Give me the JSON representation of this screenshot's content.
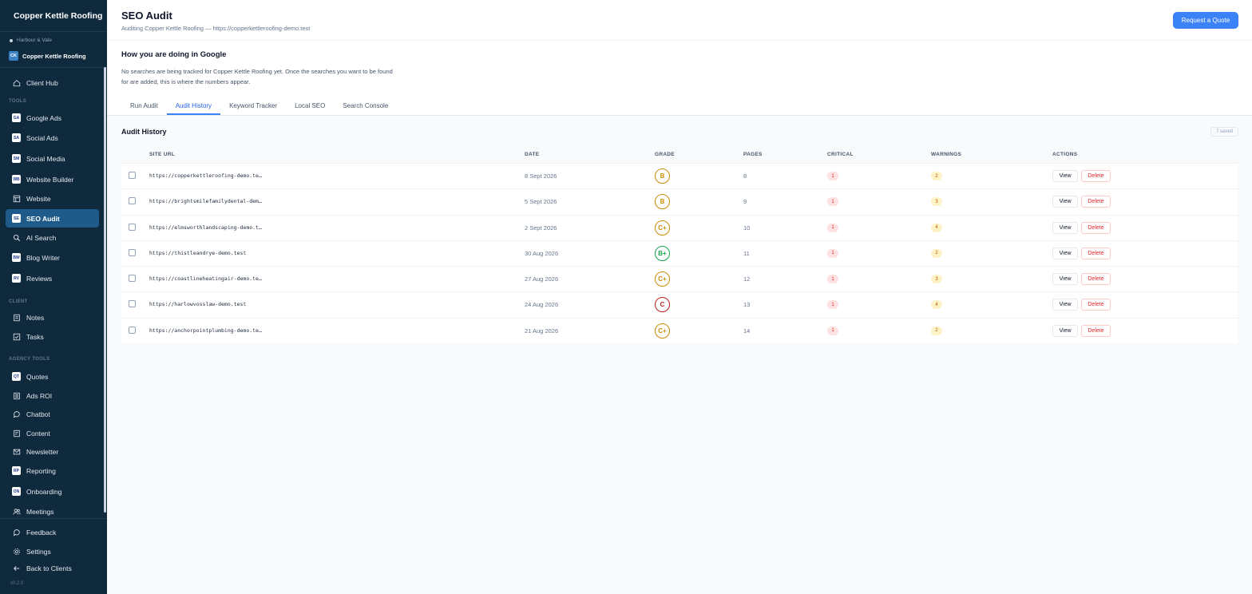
{
  "sidebar": {
    "brand": "Copper Kettle Roofing",
    "agency": "Harbour & Vale",
    "client_initials": "CK",
    "client_name": "Copper Kettle Roofing",
    "client_hub": "Client Hub",
    "tools_label": "TOOLS",
    "tools": [
      {
        "label": "Google Ads",
        "icon": "google-ads-icon"
      },
      {
        "label": "Social Ads",
        "icon": "social-ads-icon"
      },
      {
        "label": "Social Media",
        "icon": "social-media-icon"
      },
      {
        "label": "Website Builder",
        "icon": "website-builder-icon"
      },
      {
        "label": "Website",
        "icon": "layout-icon"
      },
      {
        "label": "SEO Audit",
        "icon": "seo-audit-icon"
      },
      {
        "label": "AI Search",
        "icon": "search-icon"
      },
      {
        "label": "Blog Writer",
        "icon": "blog-writer-icon"
      },
      {
        "label": "Reviews",
        "icon": "reviews-icon"
      }
    ],
    "client_label": "CLIENT",
    "client_items": [
      {
        "label": "Notes",
        "icon": "notes-icon"
      },
      {
        "label": "Tasks",
        "icon": "tasks-icon"
      }
    ],
    "agency_label": "AGENCY TOOLS",
    "agency_items": [
      {
        "label": "Quotes",
        "icon": "quotes-icon"
      },
      {
        "label": "Ads ROI",
        "icon": "ads-roi-icon"
      },
      {
        "label": "Chatbot",
        "icon": "chat-icon"
      },
      {
        "label": "Content",
        "icon": "content-icon"
      },
      {
        "label": "Newsletter",
        "icon": "mail-icon"
      },
      {
        "label": "Reporting",
        "icon": "reporting-icon"
      },
      {
        "label": "Onboarding",
        "icon": "onboarding-icon"
      },
      {
        "label": "Meetings",
        "icon": "users-icon"
      }
    ],
    "feedback": "Feedback",
    "settings": "Settings",
    "back": "Back to Clients",
    "version": "v0.2.0"
  },
  "header": {
    "title": "SEO Audit",
    "subtitle": "Auditing Copper Kettle Roofing — https://copperkettleroofing-demo.test",
    "cta": "Request a Quote"
  },
  "google": {
    "heading": "How you are doing in Google",
    "text": "No searches are being tracked for Copper Kettle Roofing yet. Once the searches you want to be found for are added, this is where the numbers appear."
  },
  "tabs": [
    "Run Audit",
    "Audit History",
    "Keyword Tracker",
    "Local SEO",
    "Search Console"
  ],
  "active_tab": "Audit History",
  "history": {
    "title": "Audit History",
    "saved": "7 saved",
    "columns": [
      "SITE URL",
      "DATE",
      "GRADE",
      "PAGES",
      "CRITICAL",
      "WARNINGS",
      "ACTIONS"
    ],
    "rows": [
      {
        "url": "https://copperkettleroofing-demo.te…",
        "date": "8 Sept 2026",
        "grade": "B",
        "pages": "8",
        "critical": "1",
        "warnings": "2",
        "grade_color": "#ca8a04"
      },
      {
        "url": "https://brightsmilefamilydental-dem…",
        "date": "5 Sept 2026",
        "grade": "B",
        "pages": "9",
        "critical": "1",
        "warnings": "3",
        "grade_color": "#ca8a04"
      },
      {
        "url": "https://elmsworthlandscaping-demo.t…",
        "date": "2 Sept 2026",
        "grade": "C+",
        "pages": "10",
        "critical": "1",
        "warnings": "4",
        "grade_color": "#ca8a04"
      },
      {
        "url": "https://thistleandrye-demo.test",
        "date": "30 Aug 2026",
        "grade": "B+",
        "pages": "11",
        "critical": "1",
        "warnings": "2",
        "grade_color": "#16a34a"
      },
      {
        "url": "https://coastlineheatingair-demo.te…",
        "date": "27 Aug 2026",
        "grade": "C+",
        "pages": "12",
        "critical": "1",
        "warnings": "3",
        "grade_color": "#ca8a04"
      },
      {
        "url": "https://harlowvosslaw-demo.test",
        "date": "24 Aug 2026",
        "grade": "C",
        "pages": "13",
        "critical": "1",
        "warnings": "4",
        "grade_color": "#b91c1c"
      },
      {
        "url": "https://anchorpointplumbing-demo.te…",
        "date": "21 Aug 2026",
        "grade": "C+",
        "pages": "14",
        "critical": "1",
        "warnings": "2",
        "grade_color": "#ca8a04"
      }
    ],
    "view_label": "View",
    "delete_label": "Delete"
  },
  "colors": {
    "sidebar_bg": "#0f2a3d",
    "active_nav": "#1e5b8a",
    "accent": "#3b82f6",
    "danger": "#dc2626",
    "warning": "#b45309"
  }
}
